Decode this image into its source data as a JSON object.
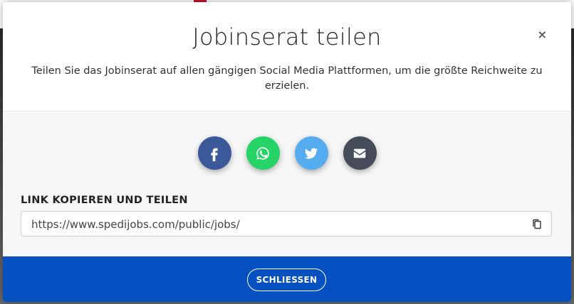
{
  "modal": {
    "title": "Jobinserat teilen",
    "close_symbol": "×",
    "description": "Teilen Sie das Jobinserat auf allen gängigen Social Media Plattformen, um die größte Reichweite zu erzielen.",
    "share_buttons": [
      {
        "name": "facebook",
        "icon": "facebook-icon",
        "color": "#3b5998"
      },
      {
        "name": "whatsapp",
        "icon": "whatsapp-icon",
        "color": "#25d366"
      },
      {
        "name": "twitter",
        "icon": "twitter-icon",
        "color": "#55acee"
      },
      {
        "name": "email",
        "icon": "envelope-icon",
        "color": "#454b59"
      }
    ],
    "link_label": "LINK KOPIEREN UND TEILEN",
    "link_value": "https://www.spedijobs.com/public/jobs/",
    "copy_icon": "copy-icon",
    "footer_button": "SCHLIESSEN",
    "footer_color": "#0550c0"
  }
}
